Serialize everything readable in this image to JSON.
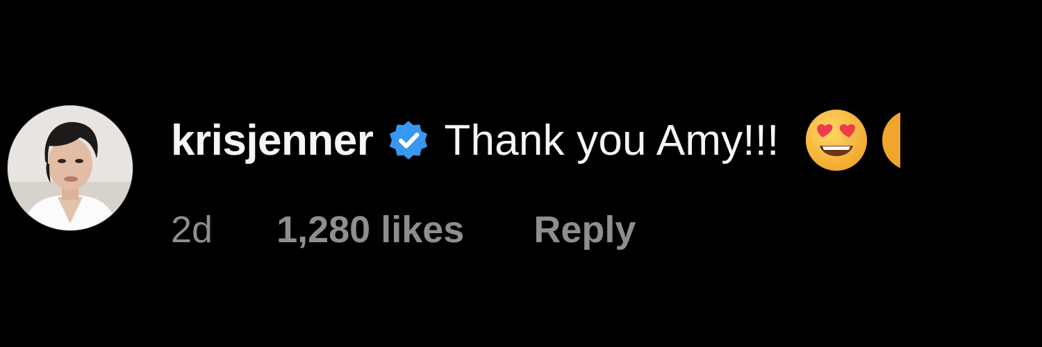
{
  "comment": {
    "username": "krisjenner",
    "verified_icon": "verified-badge-icon",
    "text": "Thank you Amy!!!",
    "emoji": "heart-eyes-emoji",
    "time": "2d",
    "likes": "1,280 likes",
    "reply_label": "Reply"
  },
  "colors": {
    "background": "#000000",
    "primary_text": "#f5f5f5",
    "secondary_text": "#8e8e8e",
    "verified_blue": "#3897f0"
  }
}
